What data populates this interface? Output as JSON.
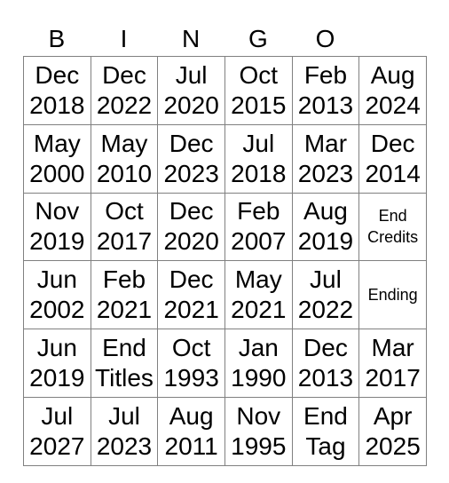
{
  "header": [
    "B",
    "I",
    "N",
    "G",
    "O"
  ],
  "grid": [
    [
      "Dec\n2018",
      "Dec\n2022",
      "Jul\n2020",
      "Oct\n2015",
      "Feb\n2013",
      "Aug\n2024"
    ],
    [
      "May\n2000",
      "May\n2010",
      "Dec\n2023",
      "Jul\n2018",
      "Mar\n2023",
      "Dec\n2014"
    ],
    [
      "Nov\n2019",
      "Oct\n2017",
      "Dec\n2020",
      "Feb\n2007",
      "Aug\n2019",
      "End\nCredits"
    ],
    [
      "Jun\n2002",
      "Feb\n2021",
      "Dec\n2021",
      "May\n2021",
      "Jul\n2022",
      "Ending"
    ],
    [
      "Jun\n2019",
      "End\nTitles",
      "Oct\n1993",
      "Jan\n1990",
      "Dec\n2013",
      "Mar\n2017"
    ],
    [
      "Jul\n2027",
      "Jul\n2023",
      "Aug\n2011",
      "Nov\n1995",
      "End\nTag",
      "Apr\n2025"
    ]
  ],
  "colors": {
    "border": "#808080",
    "text": "#000000",
    "background": "#ffffff"
  }
}
